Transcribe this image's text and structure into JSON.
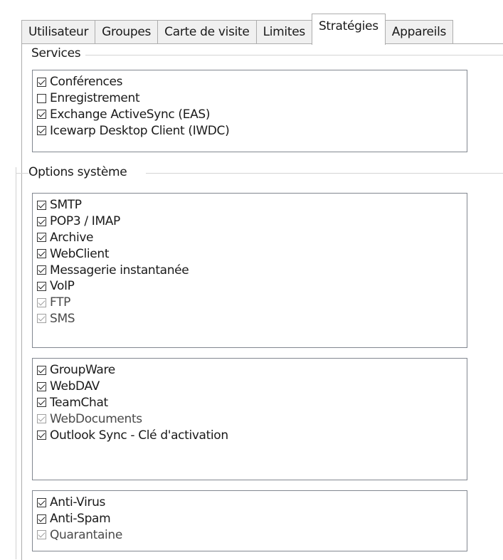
{
  "tabs": [
    {
      "label": "Utilisateur",
      "selected": false
    },
    {
      "label": "Groupes",
      "selected": false
    },
    {
      "label": "Carte de visite",
      "selected": false
    },
    {
      "label": "Limites",
      "selected": false
    },
    {
      "label": "Stratégies",
      "selected": true
    },
    {
      "label": "Appareils",
      "selected": false
    }
  ],
  "services": {
    "title": "Services",
    "items": [
      {
        "label": "Conférences",
        "checked": true,
        "enabled": true
      },
      {
        "label": "Enregistrement",
        "checked": false,
        "enabled": true
      },
      {
        "label": "Exchange ActiveSync (EAS)",
        "checked": true,
        "enabled": true
      },
      {
        "label": "Icewarp Desktop Client (IWDC)",
        "checked": true,
        "enabled": true
      }
    ]
  },
  "system_options": {
    "title": "Options système",
    "protocols": [
      {
        "label": "SMTP",
        "checked": true,
        "enabled": true
      },
      {
        "label": "POP3 / IMAP",
        "checked": true,
        "enabled": true
      },
      {
        "label": "Archive",
        "checked": true,
        "enabled": true
      },
      {
        "label": "WebClient",
        "checked": true,
        "enabled": true
      },
      {
        "label": "Messagerie instantanée",
        "checked": true,
        "enabled": true
      },
      {
        "label": "VoIP",
        "checked": true,
        "enabled": true
      },
      {
        "label": "FTP",
        "checked": true,
        "enabled": false
      },
      {
        "label": "SMS",
        "checked": true,
        "enabled": false
      }
    ],
    "collaboration": [
      {
        "label": "GroupWare",
        "checked": true,
        "enabled": true
      },
      {
        "label": "WebDAV",
        "checked": true,
        "enabled": true
      },
      {
        "label": "TeamChat",
        "checked": true,
        "enabled": true
      },
      {
        "label": "WebDocuments",
        "checked": true,
        "enabled": false
      },
      {
        "label": "Outlook Sync - Clé d'activation",
        "checked": true,
        "enabled": true
      }
    ],
    "security": [
      {
        "label": "Anti-Virus",
        "checked": true,
        "enabled": true
      },
      {
        "label": "Anti-Spam",
        "checked": true,
        "enabled": true
      },
      {
        "label": "Quarantaine",
        "checked": true,
        "enabled": false
      }
    ]
  }
}
